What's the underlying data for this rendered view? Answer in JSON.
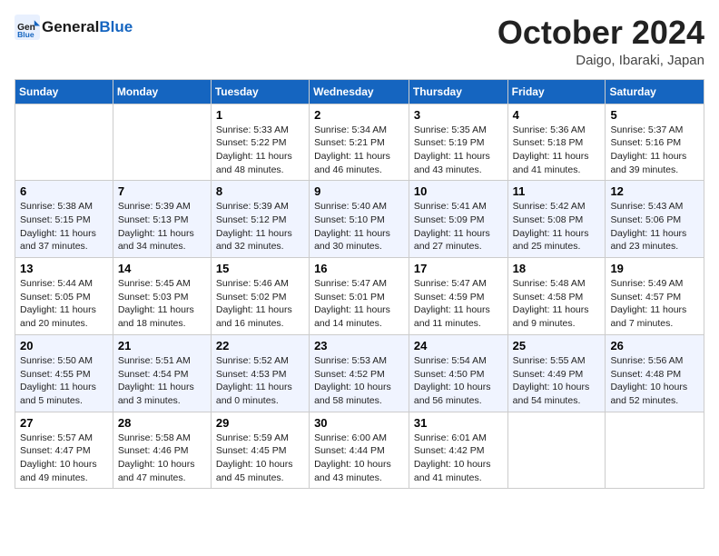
{
  "header": {
    "logo_line1": "General",
    "logo_line2": "Blue",
    "month_title": "October 2024",
    "location": "Daigo, Ibaraki, Japan"
  },
  "weekdays": [
    "Sunday",
    "Monday",
    "Tuesday",
    "Wednesday",
    "Thursday",
    "Friday",
    "Saturday"
  ],
  "weeks": [
    [
      {
        "day": "",
        "sunrise": "",
        "sunset": "",
        "daylight": ""
      },
      {
        "day": "",
        "sunrise": "",
        "sunset": "",
        "daylight": ""
      },
      {
        "day": "1",
        "sunrise": "Sunrise: 5:33 AM",
        "sunset": "Sunset: 5:22 PM",
        "daylight": "Daylight: 11 hours and 48 minutes."
      },
      {
        "day": "2",
        "sunrise": "Sunrise: 5:34 AM",
        "sunset": "Sunset: 5:21 PM",
        "daylight": "Daylight: 11 hours and 46 minutes."
      },
      {
        "day": "3",
        "sunrise": "Sunrise: 5:35 AM",
        "sunset": "Sunset: 5:19 PM",
        "daylight": "Daylight: 11 hours and 43 minutes."
      },
      {
        "day": "4",
        "sunrise": "Sunrise: 5:36 AM",
        "sunset": "Sunset: 5:18 PM",
        "daylight": "Daylight: 11 hours and 41 minutes."
      },
      {
        "day": "5",
        "sunrise": "Sunrise: 5:37 AM",
        "sunset": "Sunset: 5:16 PM",
        "daylight": "Daylight: 11 hours and 39 minutes."
      }
    ],
    [
      {
        "day": "6",
        "sunrise": "Sunrise: 5:38 AM",
        "sunset": "Sunset: 5:15 PM",
        "daylight": "Daylight: 11 hours and 37 minutes."
      },
      {
        "day": "7",
        "sunrise": "Sunrise: 5:39 AM",
        "sunset": "Sunset: 5:13 PM",
        "daylight": "Daylight: 11 hours and 34 minutes."
      },
      {
        "day": "8",
        "sunrise": "Sunrise: 5:39 AM",
        "sunset": "Sunset: 5:12 PM",
        "daylight": "Daylight: 11 hours and 32 minutes."
      },
      {
        "day": "9",
        "sunrise": "Sunrise: 5:40 AM",
        "sunset": "Sunset: 5:10 PM",
        "daylight": "Daylight: 11 hours and 30 minutes."
      },
      {
        "day": "10",
        "sunrise": "Sunrise: 5:41 AM",
        "sunset": "Sunset: 5:09 PM",
        "daylight": "Daylight: 11 hours and 27 minutes."
      },
      {
        "day": "11",
        "sunrise": "Sunrise: 5:42 AM",
        "sunset": "Sunset: 5:08 PM",
        "daylight": "Daylight: 11 hours and 25 minutes."
      },
      {
        "day": "12",
        "sunrise": "Sunrise: 5:43 AM",
        "sunset": "Sunset: 5:06 PM",
        "daylight": "Daylight: 11 hours and 23 minutes."
      }
    ],
    [
      {
        "day": "13",
        "sunrise": "Sunrise: 5:44 AM",
        "sunset": "Sunset: 5:05 PM",
        "daylight": "Daylight: 11 hours and 20 minutes."
      },
      {
        "day": "14",
        "sunrise": "Sunrise: 5:45 AM",
        "sunset": "Sunset: 5:03 PM",
        "daylight": "Daylight: 11 hours and 18 minutes."
      },
      {
        "day": "15",
        "sunrise": "Sunrise: 5:46 AM",
        "sunset": "Sunset: 5:02 PM",
        "daylight": "Daylight: 11 hours and 16 minutes."
      },
      {
        "day": "16",
        "sunrise": "Sunrise: 5:47 AM",
        "sunset": "Sunset: 5:01 PM",
        "daylight": "Daylight: 11 hours and 14 minutes."
      },
      {
        "day": "17",
        "sunrise": "Sunrise: 5:47 AM",
        "sunset": "Sunset: 4:59 PM",
        "daylight": "Daylight: 11 hours and 11 minutes."
      },
      {
        "day": "18",
        "sunrise": "Sunrise: 5:48 AM",
        "sunset": "Sunset: 4:58 PM",
        "daylight": "Daylight: 11 hours and 9 minutes."
      },
      {
        "day": "19",
        "sunrise": "Sunrise: 5:49 AM",
        "sunset": "Sunset: 4:57 PM",
        "daylight": "Daylight: 11 hours and 7 minutes."
      }
    ],
    [
      {
        "day": "20",
        "sunrise": "Sunrise: 5:50 AM",
        "sunset": "Sunset: 4:55 PM",
        "daylight": "Daylight: 11 hours and 5 minutes."
      },
      {
        "day": "21",
        "sunrise": "Sunrise: 5:51 AM",
        "sunset": "Sunset: 4:54 PM",
        "daylight": "Daylight: 11 hours and 3 minutes."
      },
      {
        "day": "22",
        "sunrise": "Sunrise: 5:52 AM",
        "sunset": "Sunset: 4:53 PM",
        "daylight": "Daylight: 11 hours and 0 minutes."
      },
      {
        "day": "23",
        "sunrise": "Sunrise: 5:53 AM",
        "sunset": "Sunset: 4:52 PM",
        "daylight": "Daylight: 10 hours and 58 minutes."
      },
      {
        "day": "24",
        "sunrise": "Sunrise: 5:54 AM",
        "sunset": "Sunset: 4:50 PM",
        "daylight": "Daylight: 10 hours and 56 minutes."
      },
      {
        "day": "25",
        "sunrise": "Sunrise: 5:55 AM",
        "sunset": "Sunset: 4:49 PM",
        "daylight": "Daylight: 10 hours and 54 minutes."
      },
      {
        "day": "26",
        "sunrise": "Sunrise: 5:56 AM",
        "sunset": "Sunset: 4:48 PM",
        "daylight": "Daylight: 10 hours and 52 minutes."
      }
    ],
    [
      {
        "day": "27",
        "sunrise": "Sunrise: 5:57 AM",
        "sunset": "Sunset: 4:47 PM",
        "daylight": "Daylight: 10 hours and 49 minutes."
      },
      {
        "day": "28",
        "sunrise": "Sunrise: 5:58 AM",
        "sunset": "Sunset: 4:46 PM",
        "daylight": "Daylight: 10 hours and 47 minutes."
      },
      {
        "day": "29",
        "sunrise": "Sunrise: 5:59 AM",
        "sunset": "Sunset: 4:45 PM",
        "daylight": "Daylight: 10 hours and 45 minutes."
      },
      {
        "day": "30",
        "sunrise": "Sunrise: 6:00 AM",
        "sunset": "Sunset: 4:44 PM",
        "daylight": "Daylight: 10 hours and 43 minutes."
      },
      {
        "day": "31",
        "sunrise": "Sunrise: 6:01 AM",
        "sunset": "Sunset: 4:42 PM",
        "daylight": "Daylight: 10 hours and 41 minutes."
      },
      {
        "day": "",
        "sunrise": "",
        "sunset": "",
        "daylight": ""
      },
      {
        "day": "",
        "sunrise": "",
        "sunset": "",
        "daylight": ""
      }
    ]
  ]
}
